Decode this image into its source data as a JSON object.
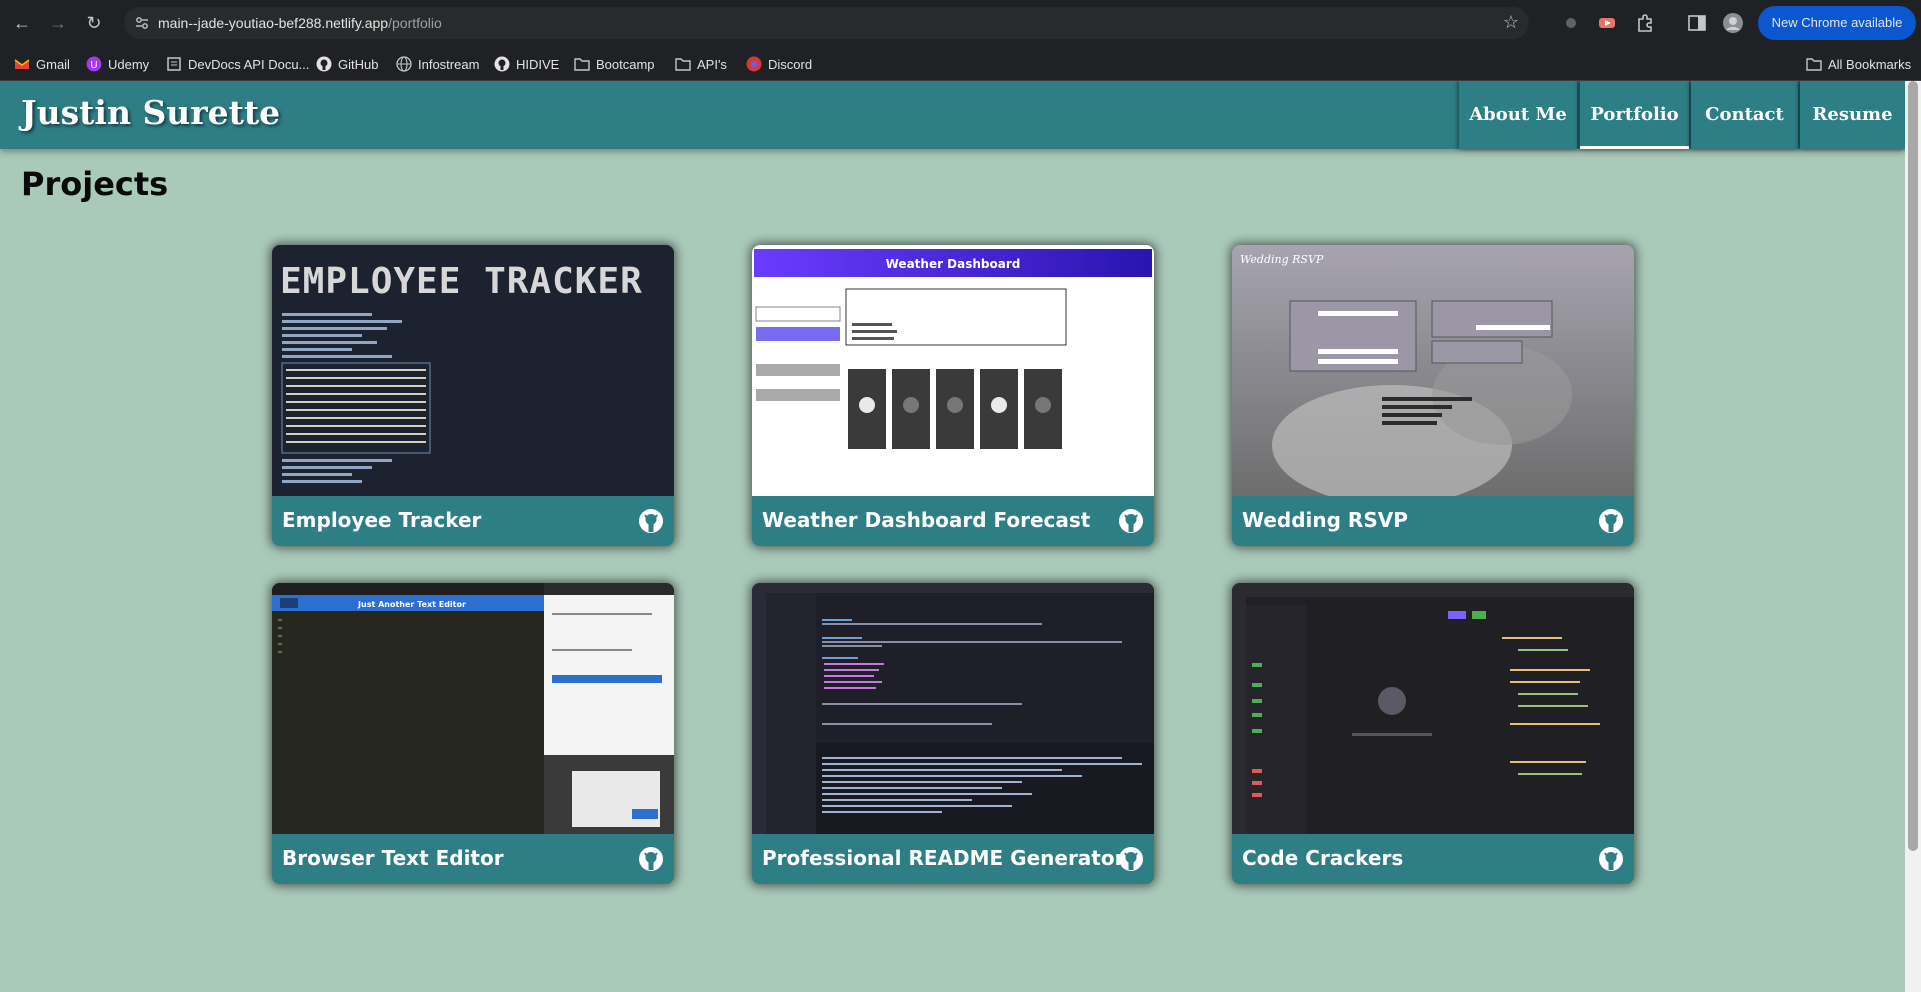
{
  "browser": {
    "url_main": "main--jade-youtiao-bef288.netlify.app",
    "url_path": "/portfolio",
    "update_button": "New Chrome available",
    "bookmarks": [
      "Gmail",
      "Udemy",
      "DevDocs API Docu...",
      "GitHub",
      "Infostream",
      "HIDIVE",
      "Bootcamp",
      "API's",
      "Discord"
    ],
    "all_bookmarks": "All Bookmarks"
  },
  "site": {
    "brand": "Justin Surette",
    "nav": [
      "About Me",
      "Portfolio",
      "Contact",
      "Resume"
    ],
    "active_nav": "Portfolio",
    "section_title": "Projects"
  },
  "projects": [
    {
      "title": "Employee Tracker",
      "thumb_text": "EMPLOYEE TRACKER"
    },
    {
      "title": "Weather Dashboard Forecast",
      "thumb_text": "Weather Dashboard"
    },
    {
      "title": "Wedding RSVP",
      "thumb_text": "Wedding RSVP"
    },
    {
      "title": "Browser Text Editor",
      "thumb_text": "Just Another Text Editor"
    },
    {
      "title": "Professional README Generator",
      "thumb_text": ""
    },
    {
      "title": "Code Crackers",
      "thumb_text": ""
    }
  ],
  "colors": {
    "page_bg": "#a9c9b9",
    "header_bg": "#2d7f85",
    "card_bar": "#2d7f85"
  }
}
